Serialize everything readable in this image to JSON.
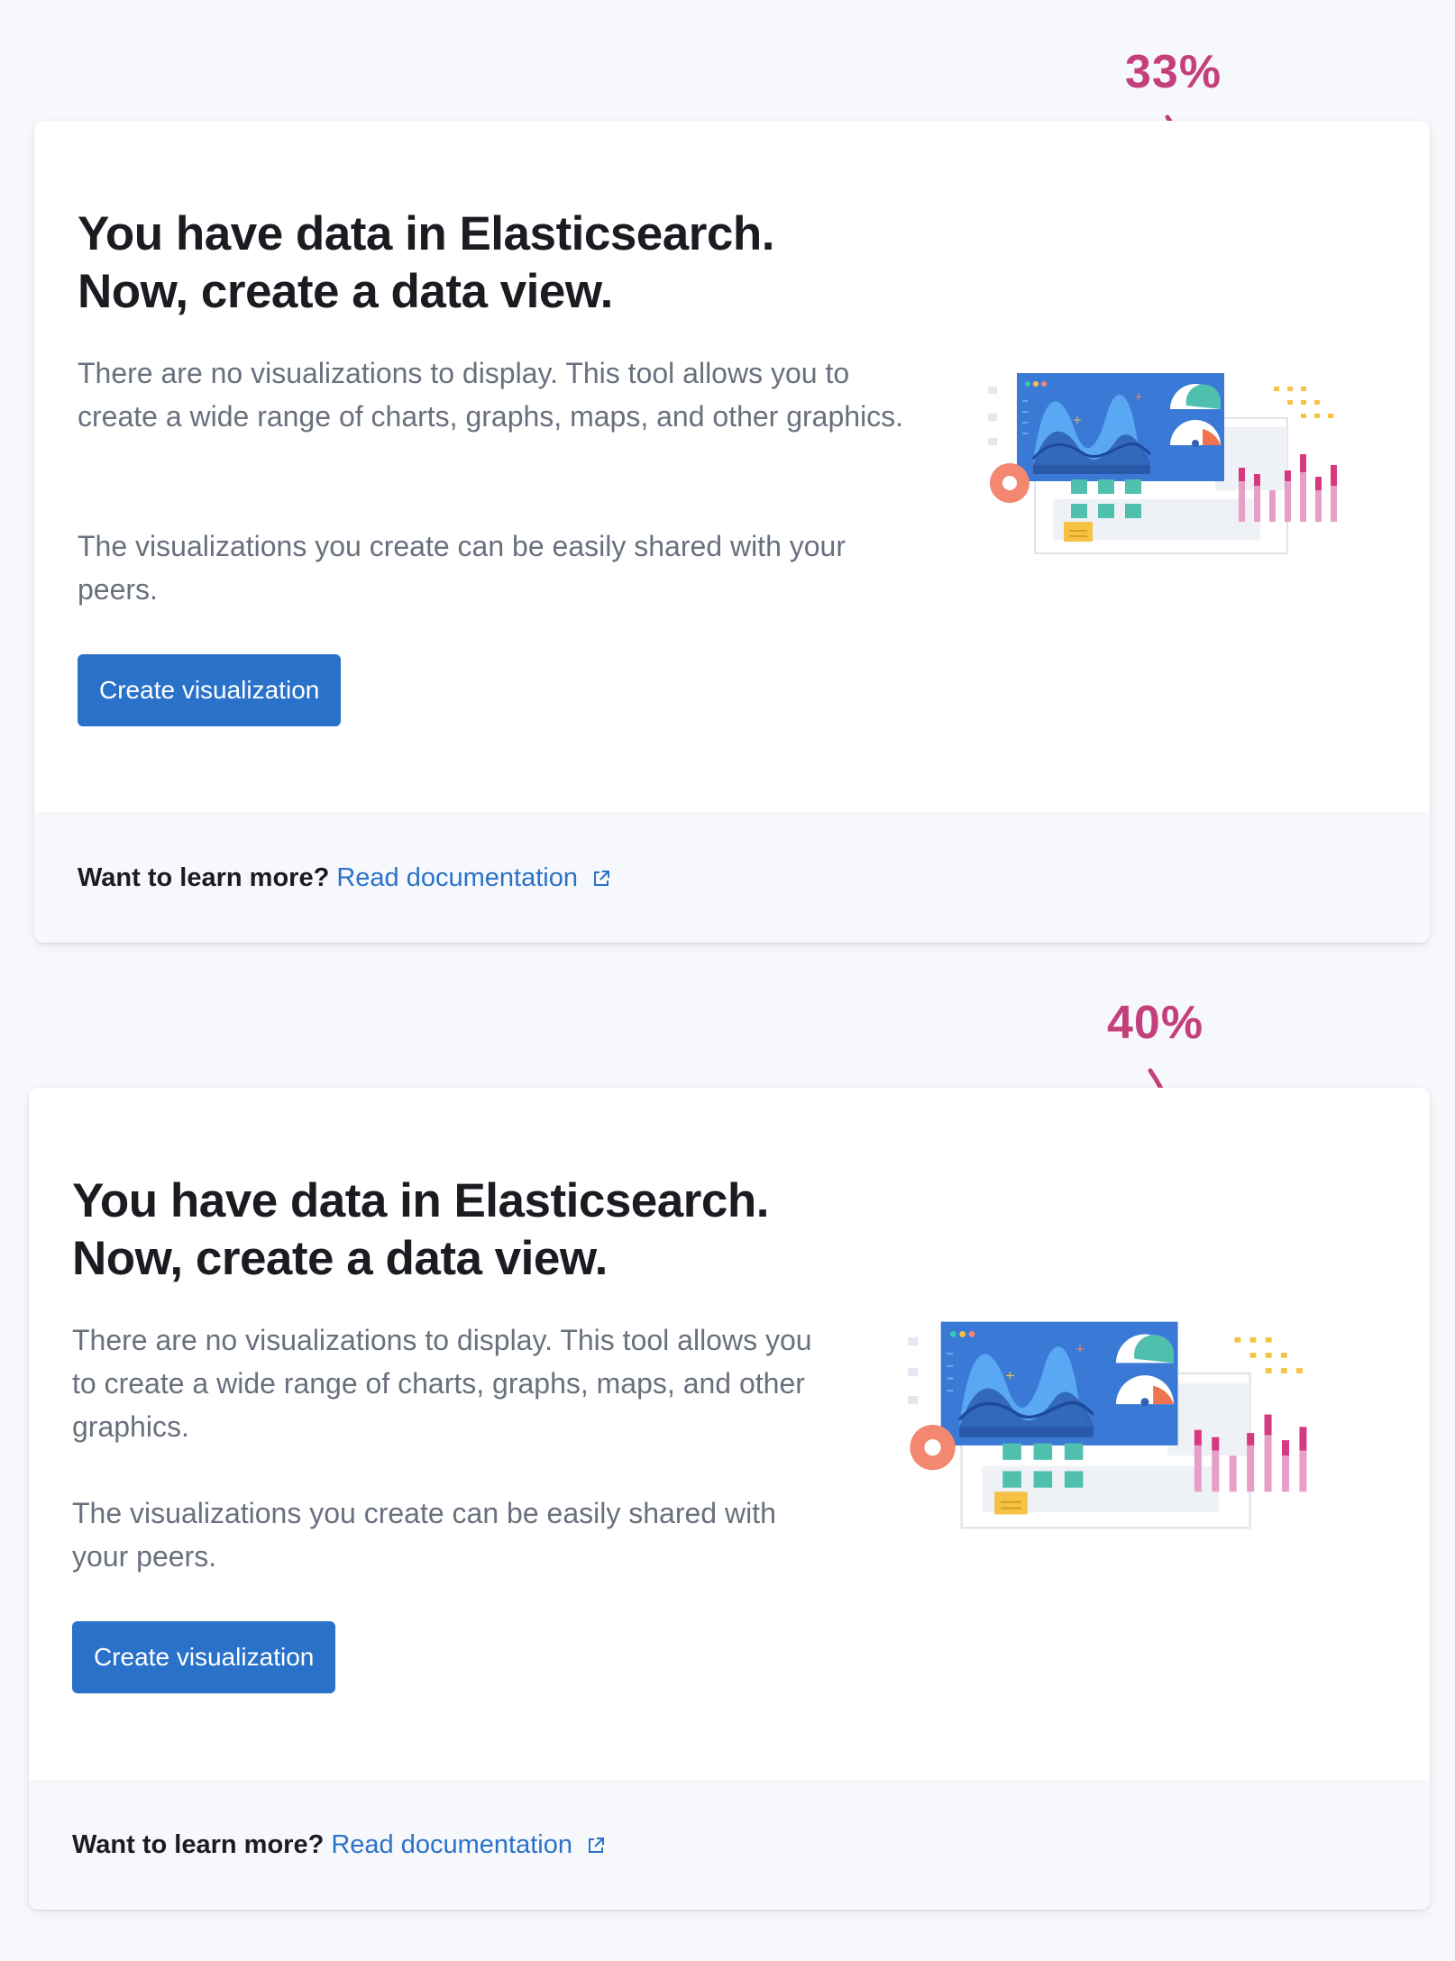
{
  "annotations": {
    "top_percent": "33%",
    "bottom_percent": "40%"
  },
  "panels": [
    {
      "title_line1": "You have data in Elasticsearch.",
      "title_line2": "Now, create a data view.",
      "desc_para1": "There are no visualizations to display. This tool allows you to create a wide range of charts, graphs, maps, and other graphics.",
      "desc_para2": "The visualizations you create can be easily shared with your peers.",
      "button_label": "Create visualization",
      "footer_question": "Want to learn more?",
      "footer_link": "Read documentation"
    },
    {
      "title_line1": "You have data in Elasticsearch.",
      "title_line2": "Now, create a data view.",
      "desc_para1": "There are no visualizations to display. This tool allows you to create a wide range of charts, graphs, maps, and other graphics.",
      "desc_para2": "The visualizations you create can be easily shared with your peers.",
      "button_label": "Create visualization",
      "footer_question": "Want to learn more?",
      "footer_link": "Read documentation"
    }
  ],
  "colors": {
    "accent": "#2a72c9",
    "annotation": "#c4407c",
    "title": "#1a1c21",
    "body_text": "#69707d"
  },
  "icons": [
    "external-link-icon",
    "arrow-down-icon",
    "dashboard-illustration"
  ]
}
